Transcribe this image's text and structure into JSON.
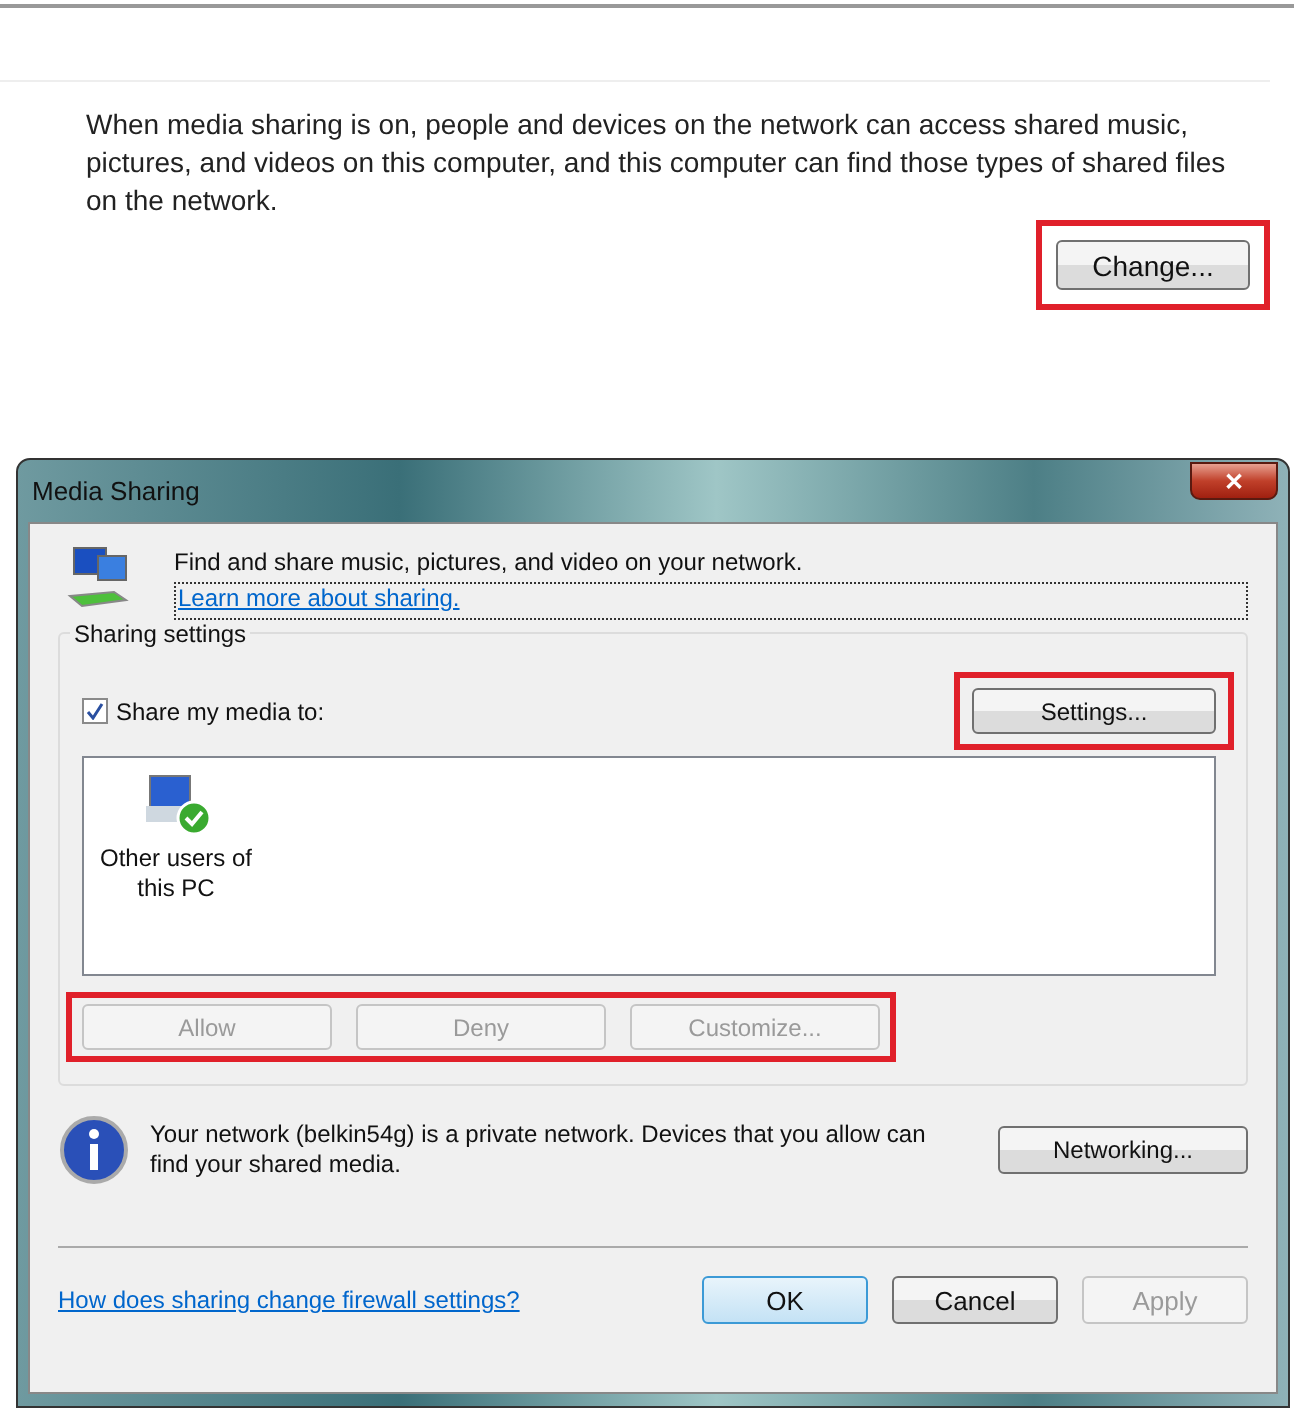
{
  "intro": {
    "text": "When media sharing is on, people and devices on the network can access shared music, pictures, and videos on this computer, and this computer can find those types of shared files on the network.",
    "button": {
      "label": "Change...",
      "highlighted": true
    }
  },
  "dialog": {
    "title": "Media Sharing",
    "close": "✕",
    "header": {
      "text": "Find and share music, pictures, and video on your network.",
      "link": "Learn more about sharing."
    },
    "group": {
      "label": "Sharing settings",
      "share_checkbox": {
        "label": "Share my media to:",
        "checked": true
      },
      "settings_button": {
        "label": "Settings...",
        "highlighted": true
      },
      "devices": [
        {
          "label": "Other users of this PC",
          "allowed": true
        }
      ],
      "device_buttons": {
        "highlighted": true,
        "buttons": [
          {
            "label": "Allow",
            "disabled": true
          },
          {
            "label": "Deny",
            "disabled": true
          },
          {
            "label": "Customize...",
            "disabled": true
          }
        ]
      }
    },
    "info": {
      "text": "Your network (belkin54g) is a private network. Devices that you allow can find your shared media.",
      "button": "Networking..."
    },
    "footer": {
      "link": "How does sharing change firewall settings?",
      "buttons": [
        {
          "label": "OK",
          "default": true,
          "disabled": false
        },
        {
          "label": "Cancel",
          "default": false,
          "disabled": false
        },
        {
          "label": "Apply",
          "default": false,
          "disabled": true
        }
      ]
    }
  }
}
